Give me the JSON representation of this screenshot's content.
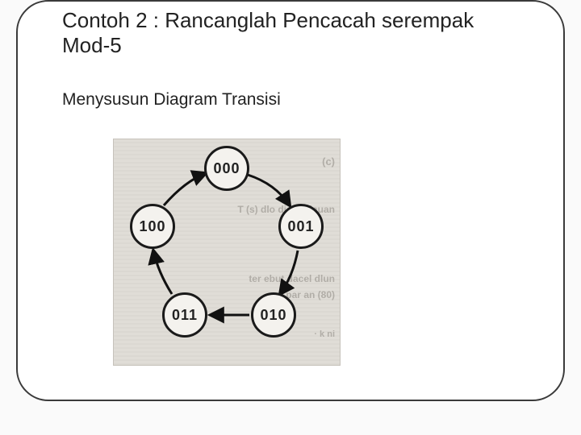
{
  "title": "Contoh 2 : Rancanglah Pencacah serempak Mod-5",
  "subtitle": "Menysusun Diagram Transisi",
  "diagram": {
    "type": "state-transition",
    "modulus": 5,
    "states": {
      "s000": "000",
      "s001": "001",
      "s010": "010",
      "s011": "011",
      "s100": "100"
    },
    "transitions": [
      [
        "000",
        "001"
      ],
      [
        "001",
        "010"
      ],
      [
        "010",
        "011"
      ],
      [
        "011",
        "100"
      ],
      [
        "100",
        "000"
      ]
    ]
  },
  "ghost_text": {
    "g1": "(c)",
    "g2": "T (s) dlo di txo tlauan",
    "g3": "ter ebut dacel dlun",
    "g4": "a par an (80)",
    "g5": "· k ni"
  }
}
